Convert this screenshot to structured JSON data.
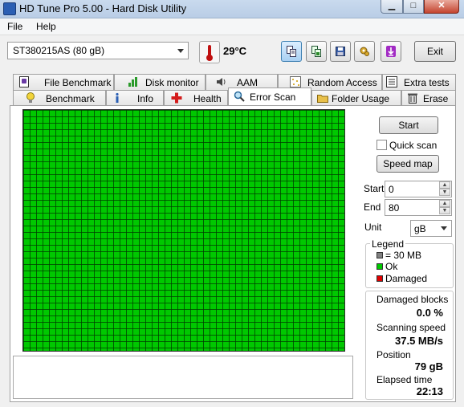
{
  "window": {
    "title": "HD Tune Pro 5.00 - Hard Disk Utility"
  },
  "menu": {
    "file": "File",
    "help": "Help"
  },
  "toolbar": {
    "drive": "ST380215AS (80 gB)",
    "temperature": "29°C",
    "exit_label": "Exit"
  },
  "tabs_top": [
    "File Benchmark",
    "Disk monitor",
    "AAM",
    "Random Access",
    "Extra tests"
  ],
  "tabs_bottom": [
    "Benchmark",
    "Info",
    "Health",
    "Error Scan",
    "Folder Usage",
    "Erase"
  ],
  "selected_tab": "Error Scan",
  "controls": {
    "start_button": "Start",
    "quick_scan_label": "Quick scan",
    "quick_scan_checked": false,
    "speed_map_button": "Speed map",
    "start_label": "Start",
    "start_value": "0",
    "end_label": "End",
    "end_value": "80",
    "unit_label": "Unit",
    "unit_value": "gB"
  },
  "legend": {
    "title": "Legend",
    "block_size": "= 30 MB",
    "ok": "Ok",
    "damaged": "Damaged",
    "colors": {
      "block": "#808080",
      "ok": "#00c800",
      "damaged": "#e00000"
    }
  },
  "stats": {
    "damaged_blocks_label": "Damaged blocks",
    "damaged_blocks_value": "0.0 %",
    "scanning_speed_label": "Scanning speed",
    "scanning_speed_value": "37.5 MB/s",
    "position_label": "Position",
    "position_value": "79 gB",
    "elapsed_label": "Elapsed time",
    "elapsed_value": "22:13"
  }
}
